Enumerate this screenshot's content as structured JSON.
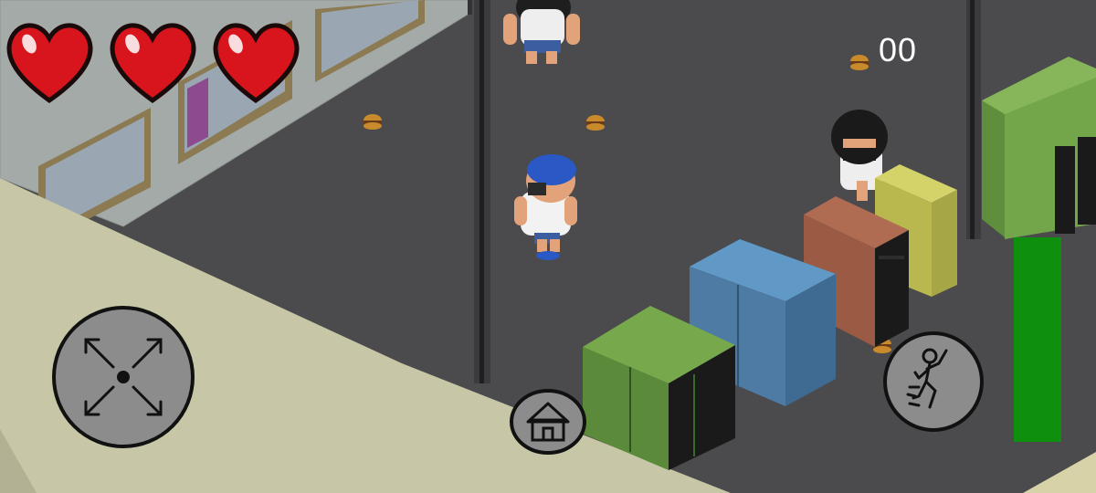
{
  "hud": {
    "lives": 3,
    "max_lives": 3,
    "score": "00",
    "stamina_fraction": 1.0,
    "heart_color": "#d8141c",
    "stamina_color": "#0e8f0e"
  },
  "controls": {
    "joystick_icon": "move-arrows-icon",
    "home_icon": "home-icon",
    "action_icon": "jump-kick-icon"
  },
  "scene": {
    "floor_color": "#4a4a4c",
    "wall_color": "#c7c6a6",
    "locker_colors": [
      "#5b8b3a",
      "#4d7ba4",
      "#9b5a44",
      "#b9b84e",
      "#73a64a"
    ],
    "player_cap_color": "#2a58c4"
  }
}
